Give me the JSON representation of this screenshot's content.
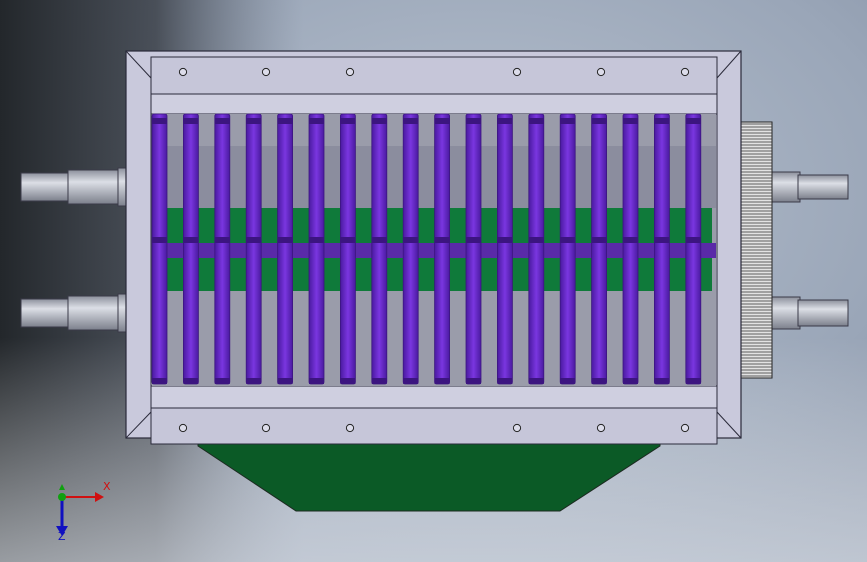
{
  "viewport": {
    "background_top": "#7e8ea4",
    "background_mid": "#a9b4c4",
    "background_left_dark": "#2a2e33",
    "background_bottom": "#c4cbd6"
  },
  "model": {
    "frame_color": "#c9c9dc",
    "frame_edge": "#2a2a3a",
    "blade_color": "#6a2bd0",
    "blade_dark": "#3c1580",
    "spacer_color": "#0f7a3a",
    "hopper_color": "#0b5a26",
    "shaft_color": "#b8bcc8",
    "gear_color": "#d8d8d8",
    "blade_count": 18,
    "bolts_per_row": 6
  },
  "triad": {
    "x_label": "X",
    "z_label": "Z",
    "x_color": "#d01010",
    "y_color": "#10a010",
    "z_color": "#1010c0"
  }
}
